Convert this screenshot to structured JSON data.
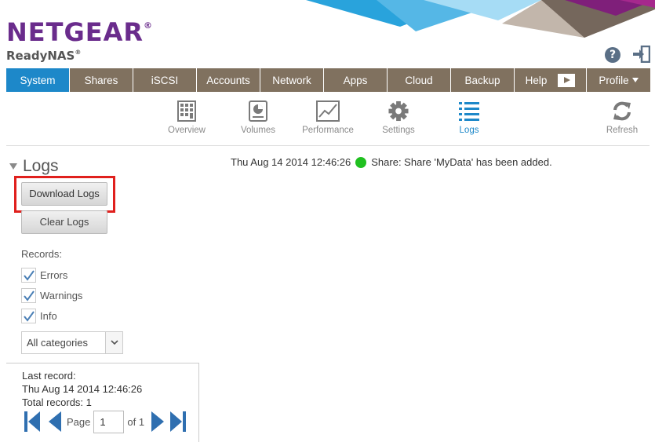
{
  "header": {
    "brand": "NETGEAR",
    "brand_mark": "®",
    "product": "ReadyNAS",
    "product_mark": "®",
    "help_label": "?"
  },
  "nav": {
    "tabs": [
      {
        "label": "System",
        "active": true
      },
      {
        "label": "Shares"
      },
      {
        "label": "iSCSI"
      },
      {
        "label": "Accounts"
      },
      {
        "label": "Network"
      },
      {
        "label": "Apps"
      },
      {
        "label": "Cloud"
      },
      {
        "label": "Backup"
      },
      {
        "label": "Help"
      },
      {
        "label": "Profile"
      }
    ]
  },
  "subnav": {
    "items": [
      {
        "label": "Overview",
        "icon": "overview-icon"
      },
      {
        "label": "Volumes",
        "icon": "volumes-icon"
      },
      {
        "label": "Performance",
        "icon": "performance-icon"
      },
      {
        "label": "Settings",
        "icon": "gear-icon"
      },
      {
        "label": "Logs",
        "icon": "list-icon",
        "active": true
      },
      {
        "label": "Refresh",
        "icon": "refresh-icon"
      }
    ]
  },
  "panel": {
    "title": "Logs",
    "download_label": "Download Logs",
    "clear_label": "Clear Logs",
    "records_label": "Records:",
    "filters": [
      {
        "label": "Errors",
        "checked": true
      },
      {
        "label": "Warnings",
        "checked": true
      },
      {
        "label": "Info",
        "checked": true
      }
    ],
    "category_value": "All categories",
    "last_record_label": "Last record:",
    "last_record_value": "Thu Aug 14 2014 12:46:26",
    "total_records": "Total records: 1",
    "pager": {
      "page_label": "Page",
      "page_value": "1",
      "of_label": "of 1"
    }
  },
  "log": {
    "entries": [
      {
        "timestamp": "Thu Aug 14 2014 12:46:26",
        "status_color": "#20c020",
        "message": "Share: Share 'MyData' has been added."
      }
    ]
  },
  "colors": {
    "brand": "#6a2c8c",
    "nav_bg": "#80715f",
    "nav_active": "#1d88c9",
    "highlight": "#e0201d"
  }
}
